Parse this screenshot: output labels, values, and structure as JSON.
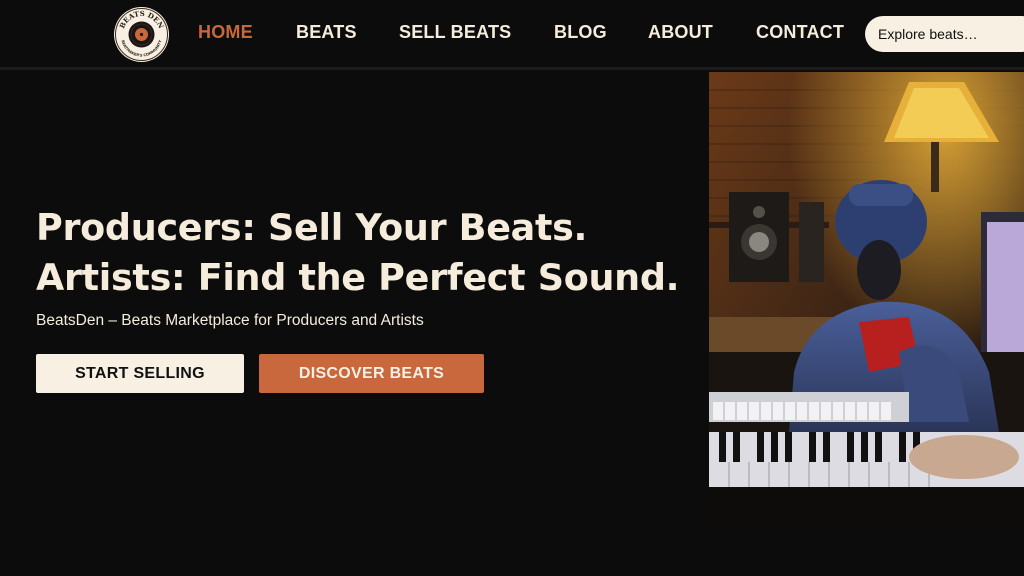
{
  "brand": {
    "logo_top_text": "BEATS DEN",
    "logo_bottom_text": "BEATMAKER'S COMMUNITY"
  },
  "nav": {
    "items": [
      {
        "label": "HOME",
        "active": true
      },
      {
        "label": "BEATS",
        "active": false
      },
      {
        "label": "SELL BEATS",
        "active": false
      },
      {
        "label": "BLOG",
        "active": false
      },
      {
        "label": "ABOUT",
        "active": false
      },
      {
        "label": "CONTACT",
        "active": false
      }
    ]
  },
  "search": {
    "placeholder": "Explore beats…"
  },
  "hero": {
    "title_line1": "Producers: Sell Your Beats.",
    "title_line2": "Artists: Find the Perfect Sound.",
    "subtitle": "BeatsDen – Beats Marketplace for Producers and Artists",
    "primary_button": "START SELLING",
    "secondary_button": "DISCOVER BEATS"
  },
  "colors": {
    "background": "#0c0c0c",
    "accent": "#c8683c",
    "cream": "#f7f0e3"
  }
}
